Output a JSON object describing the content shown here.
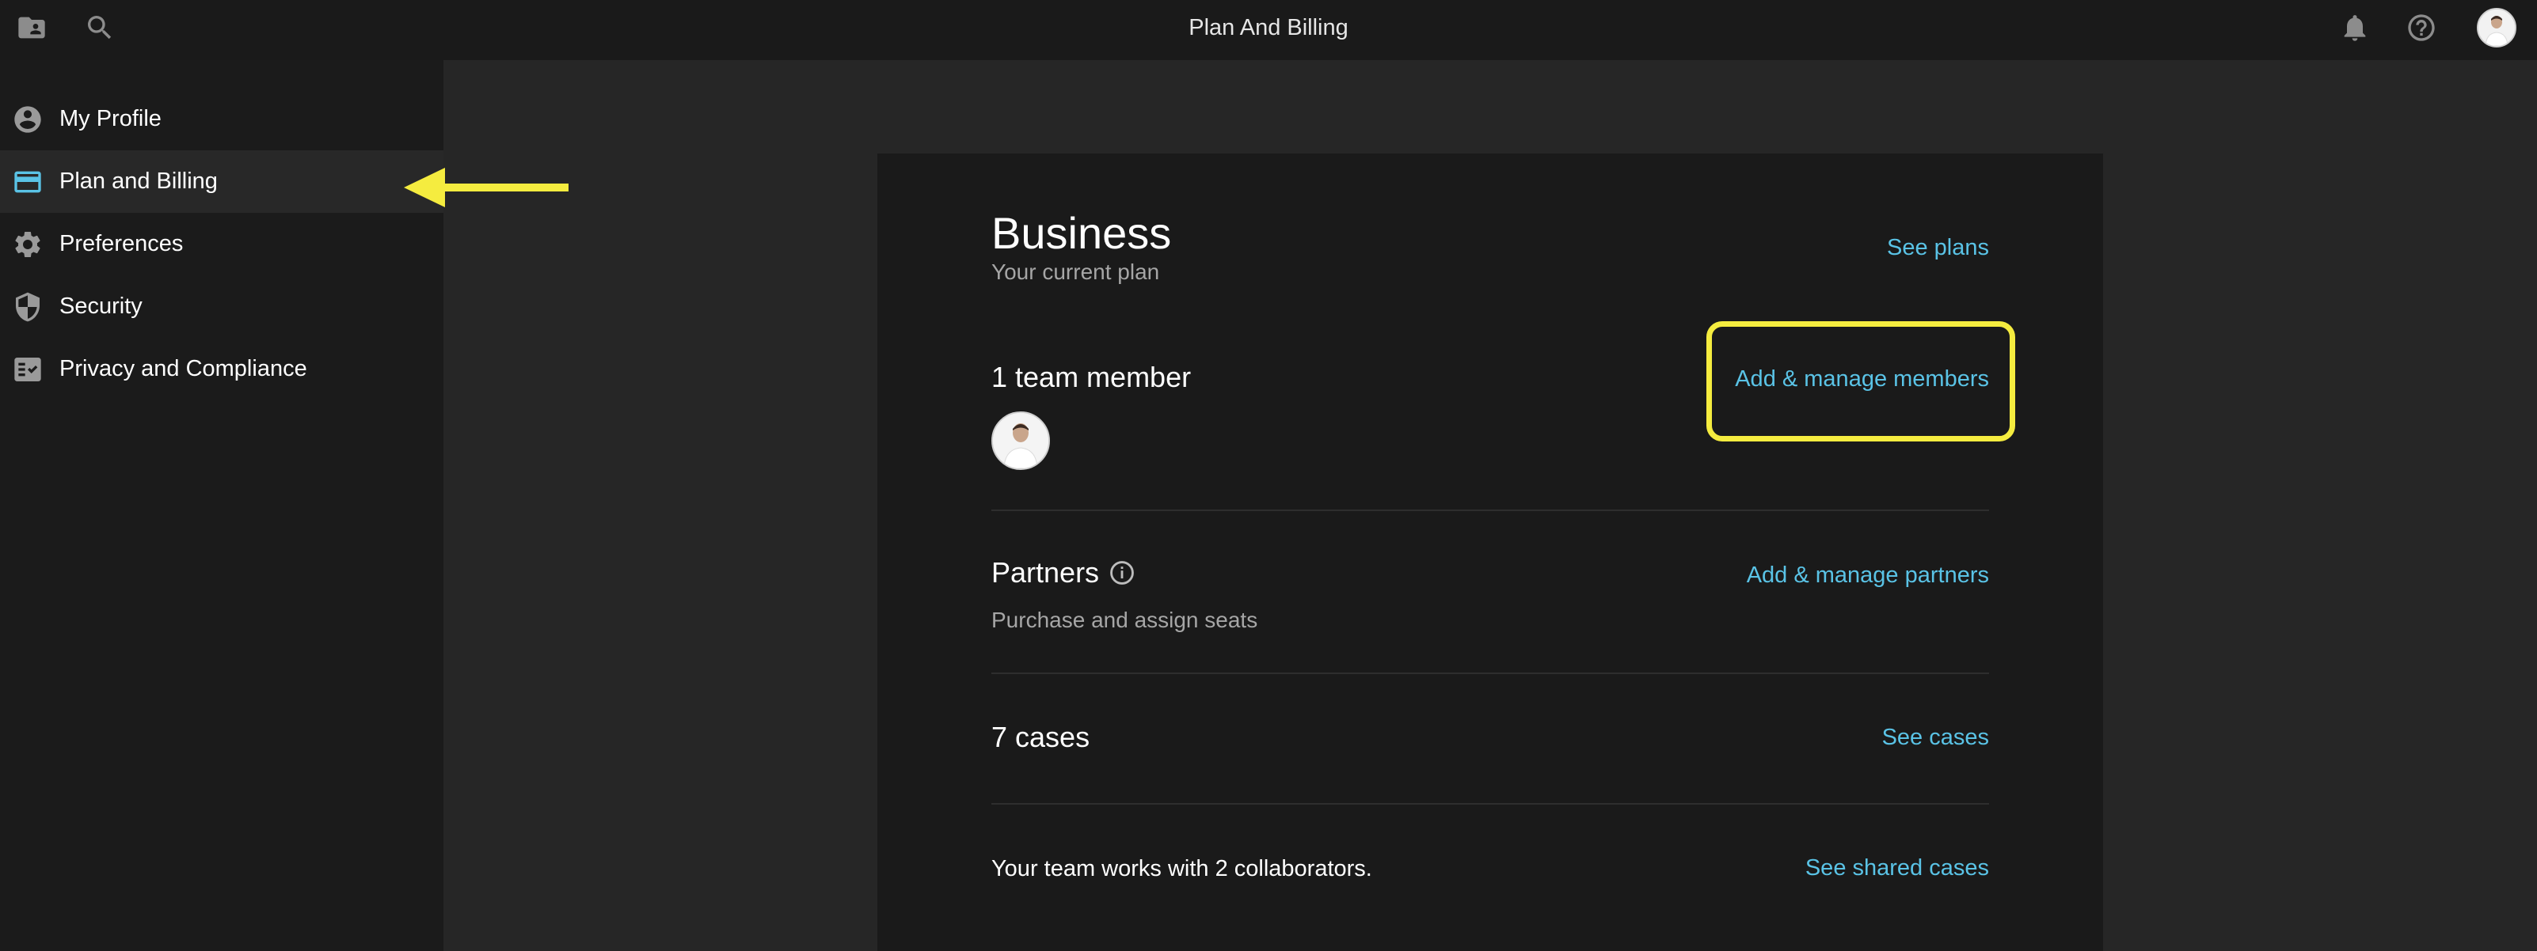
{
  "topbar": {
    "title": "Plan And Billing",
    "icons": [
      "folder-person-icon",
      "search-icon",
      "bell-icon",
      "help-icon",
      "avatar"
    ]
  },
  "sidebar": {
    "items": [
      {
        "label": "My Profile",
        "icon": "account-circle-icon",
        "active": false
      },
      {
        "label": "Plan and Billing",
        "icon": "credit-card-icon",
        "active": true
      },
      {
        "label": "Preferences",
        "icon": "gear-icon",
        "active": false
      },
      {
        "label": "Security",
        "icon": "shield-icon",
        "active": false
      },
      {
        "label": "Privacy and Compliance",
        "icon": "fact-check-icon",
        "active": false
      }
    ]
  },
  "plan": {
    "name": "Business",
    "subtitle": "Your current plan",
    "see_plans": "See plans"
  },
  "members": {
    "title": "1 team member",
    "action": "Add & manage members"
  },
  "partners": {
    "title": "Partners",
    "description": "Purchase and assign seats",
    "action": "Add & manage partners"
  },
  "cases": {
    "title": "7 cases",
    "action": "See cases"
  },
  "collaborators": {
    "text": "Your team works with 2 collaborators.",
    "action": "See shared cases"
  },
  "colors": {
    "accent": "#5ac3e6",
    "highlight": "#f5ec3f",
    "background": "#262626",
    "card": "#1a1a1a"
  }
}
